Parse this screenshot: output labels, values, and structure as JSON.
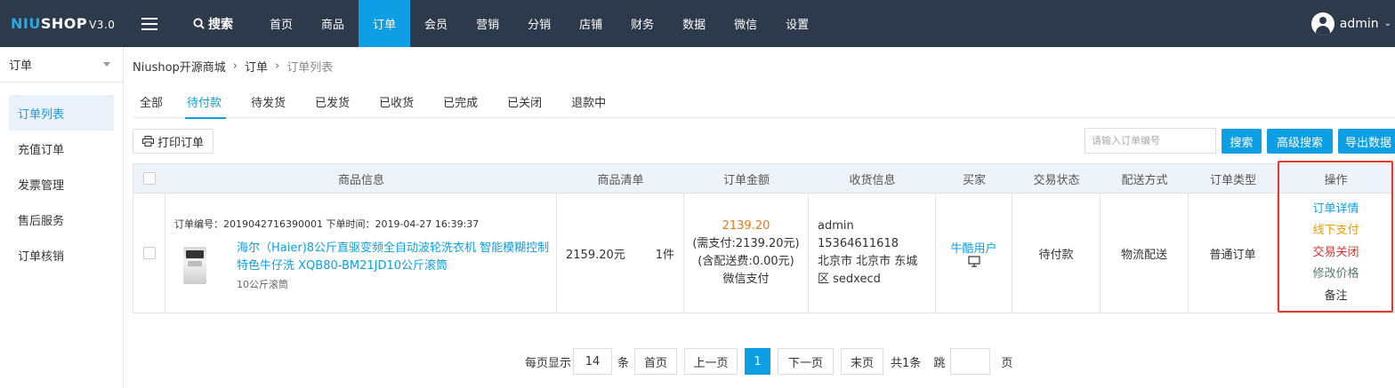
{
  "app": {
    "logo_part1": "NIU",
    "logo_part2": "SHOP",
    "logo_version": "V3.0"
  },
  "topnav": {
    "search_label": "搜索",
    "items": [
      "首页",
      "商品",
      "订单",
      "会员",
      "营销",
      "分销",
      "店铺",
      "财务",
      "数据",
      "微信",
      "设置"
    ],
    "active": "订单",
    "user": "admin"
  },
  "sidebar": {
    "header": "订单",
    "items": [
      "订单列表",
      "充值订单",
      "发票管理",
      "售后服务",
      "订单核销"
    ],
    "active": "订单列表"
  },
  "breadcrumb": [
    "Niushop开源商城",
    "订单",
    "订单列表"
  ],
  "tabs": [
    "全部",
    "待付款",
    "待发货",
    "已发货",
    "已收货",
    "已完成",
    "已关闭",
    "退款中"
  ],
  "active_tab": "待付款",
  "toolbar": {
    "print_label": "打印订单",
    "search_placeholder": "请输入订单编号",
    "search_btn": "搜索",
    "advanced_btn": "高级搜索",
    "export_btn": "导出数据"
  },
  "table": {
    "headers": [
      "商品信息",
      "商品清单",
      "订单金额",
      "收货信息",
      "买家",
      "交易状态",
      "配送方式",
      "订单类型",
      "操作"
    ],
    "row": {
      "order_meta": "订单编号：2019042716390001 下单时间：2019-04-27 16:39:37",
      "goods_name": "海尔（Haier)8公斤直驱变频全自动波轮洗衣机 智能模糊控制 特色牛仔洗 XQB80-BM21JD10公斤滚筒",
      "goods_spec": "10公斤滚筒",
      "unit_price": "2159.20元",
      "quantity": "1件",
      "amount": "2139.20",
      "amount_need": "(需支付:2139.20元)",
      "amount_shipping": "(含配送费:0.00元)",
      "payment": "微信支付",
      "ship_name": "admin",
      "ship_phone": "15364611618",
      "ship_addr1": "北京市 北京市 东城",
      "ship_addr2": "区 sedxecd",
      "buyer": "牛酷用户",
      "status": "待付款",
      "delivery": "物流配送",
      "order_type": "普通订单",
      "ops": [
        "订单详情",
        "线下支付",
        "交易关闭",
        "修改价格",
        "备注"
      ]
    }
  },
  "pagination": {
    "per_page_label": "每页显示",
    "per_page": "14",
    "unit": "条",
    "first": "首页",
    "prev": "上一页",
    "current": "1",
    "next": "下一页",
    "last": "末页",
    "total": "共1条",
    "jump_label": "跳",
    "page_label": "页"
  },
  "colors": {
    "topbar": "#2d3a4b",
    "accent": "#0d9ee4",
    "highlight_border": "#e53a2b"
  }
}
